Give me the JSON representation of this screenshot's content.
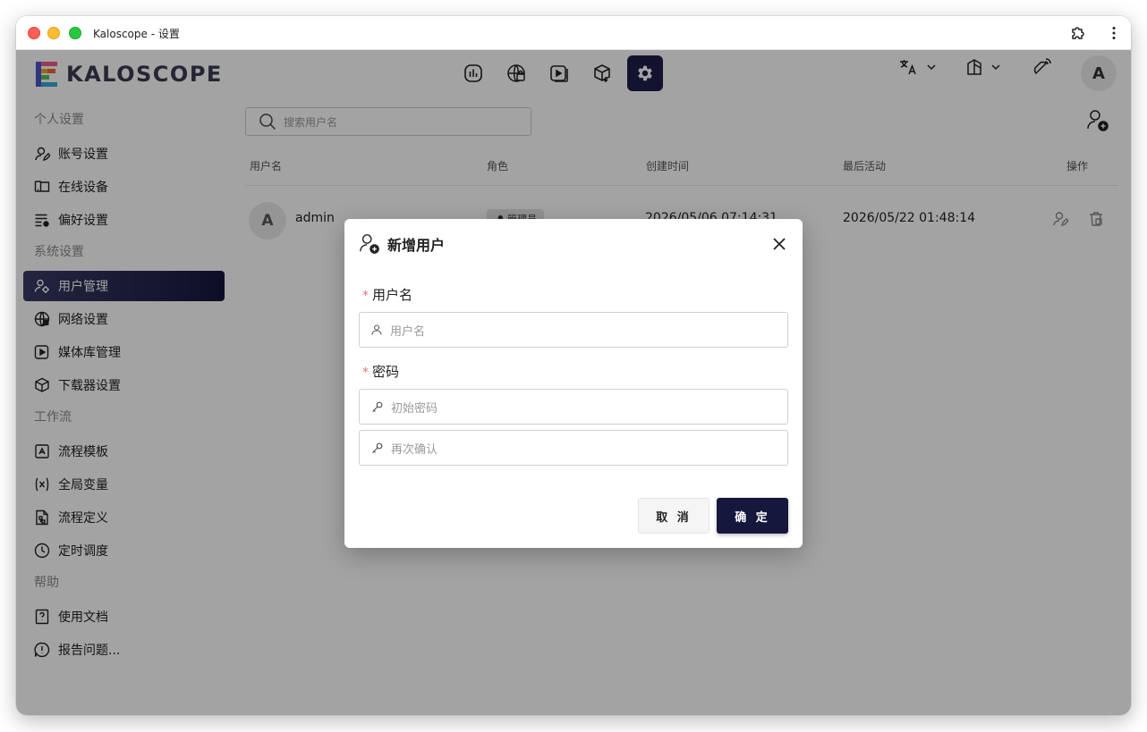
{
  "window": {
    "title": "Kaloscope - 设置"
  },
  "brand": {
    "name": "KALOSCOPE",
    "accent": "#1e1f4b"
  },
  "topnav": {
    "icons": [
      "stats-icon",
      "globe-icon",
      "media-play-icon",
      "package-download-icon",
      "gear-icon"
    ],
    "active": "gear-icon"
  },
  "header": {
    "avatar": "A"
  },
  "sidebar": {
    "sections": [
      {
        "title": "个人设置",
        "items": [
          {
            "label": "账号设置",
            "icon": "account-edit-icon"
          },
          {
            "label": "在线设备",
            "icon": "devices-icon"
          },
          {
            "label": "偏好设置",
            "icon": "preferences-icon"
          }
        ]
      },
      {
        "title": "系统设置",
        "items": [
          {
            "label": "用户管理",
            "icon": "users-gear-icon",
            "active": true
          },
          {
            "label": "网络设置",
            "icon": "network-icon"
          },
          {
            "label": "媒体库管理",
            "icon": "media-library-icon"
          },
          {
            "label": "下载器设置",
            "icon": "downloader-icon"
          }
        ]
      },
      {
        "title": "工作流",
        "items": [
          {
            "label": "流程模板",
            "icon": "template-icon"
          },
          {
            "label": "全局变量",
            "icon": "variable-icon"
          },
          {
            "label": "流程定义",
            "icon": "flow-definition-icon"
          },
          {
            "label": "定时调度",
            "icon": "clock-icon"
          }
        ]
      },
      {
        "title": "帮助",
        "items": [
          {
            "label": "使用文档",
            "icon": "help-doc-icon"
          },
          {
            "label": "报告问题...",
            "icon": "report-issue-icon"
          }
        ]
      }
    ]
  },
  "search": {
    "placeholder": "搜索用户名"
  },
  "table": {
    "headers": {
      "username": "用户名",
      "role": "角色",
      "created": "创建时间",
      "last_active": "最后活动",
      "actions": "操作"
    },
    "rows": [
      {
        "avatar": "A",
        "username": "admin",
        "role": "管理员",
        "created": "2026/05/06 07:14:31",
        "last_active": "2026/05/22 01:48:14"
      }
    ]
  },
  "modal": {
    "title": "新增用户",
    "username_label": "用户名",
    "username_placeholder": "用户名",
    "password_label": "密码",
    "password_placeholder": "初始密码",
    "confirm_placeholder": "再次确认",
    "required_mark": "*",
    "cancel_label": "取 消",
    "ok_label": "确 定"
  }
}
